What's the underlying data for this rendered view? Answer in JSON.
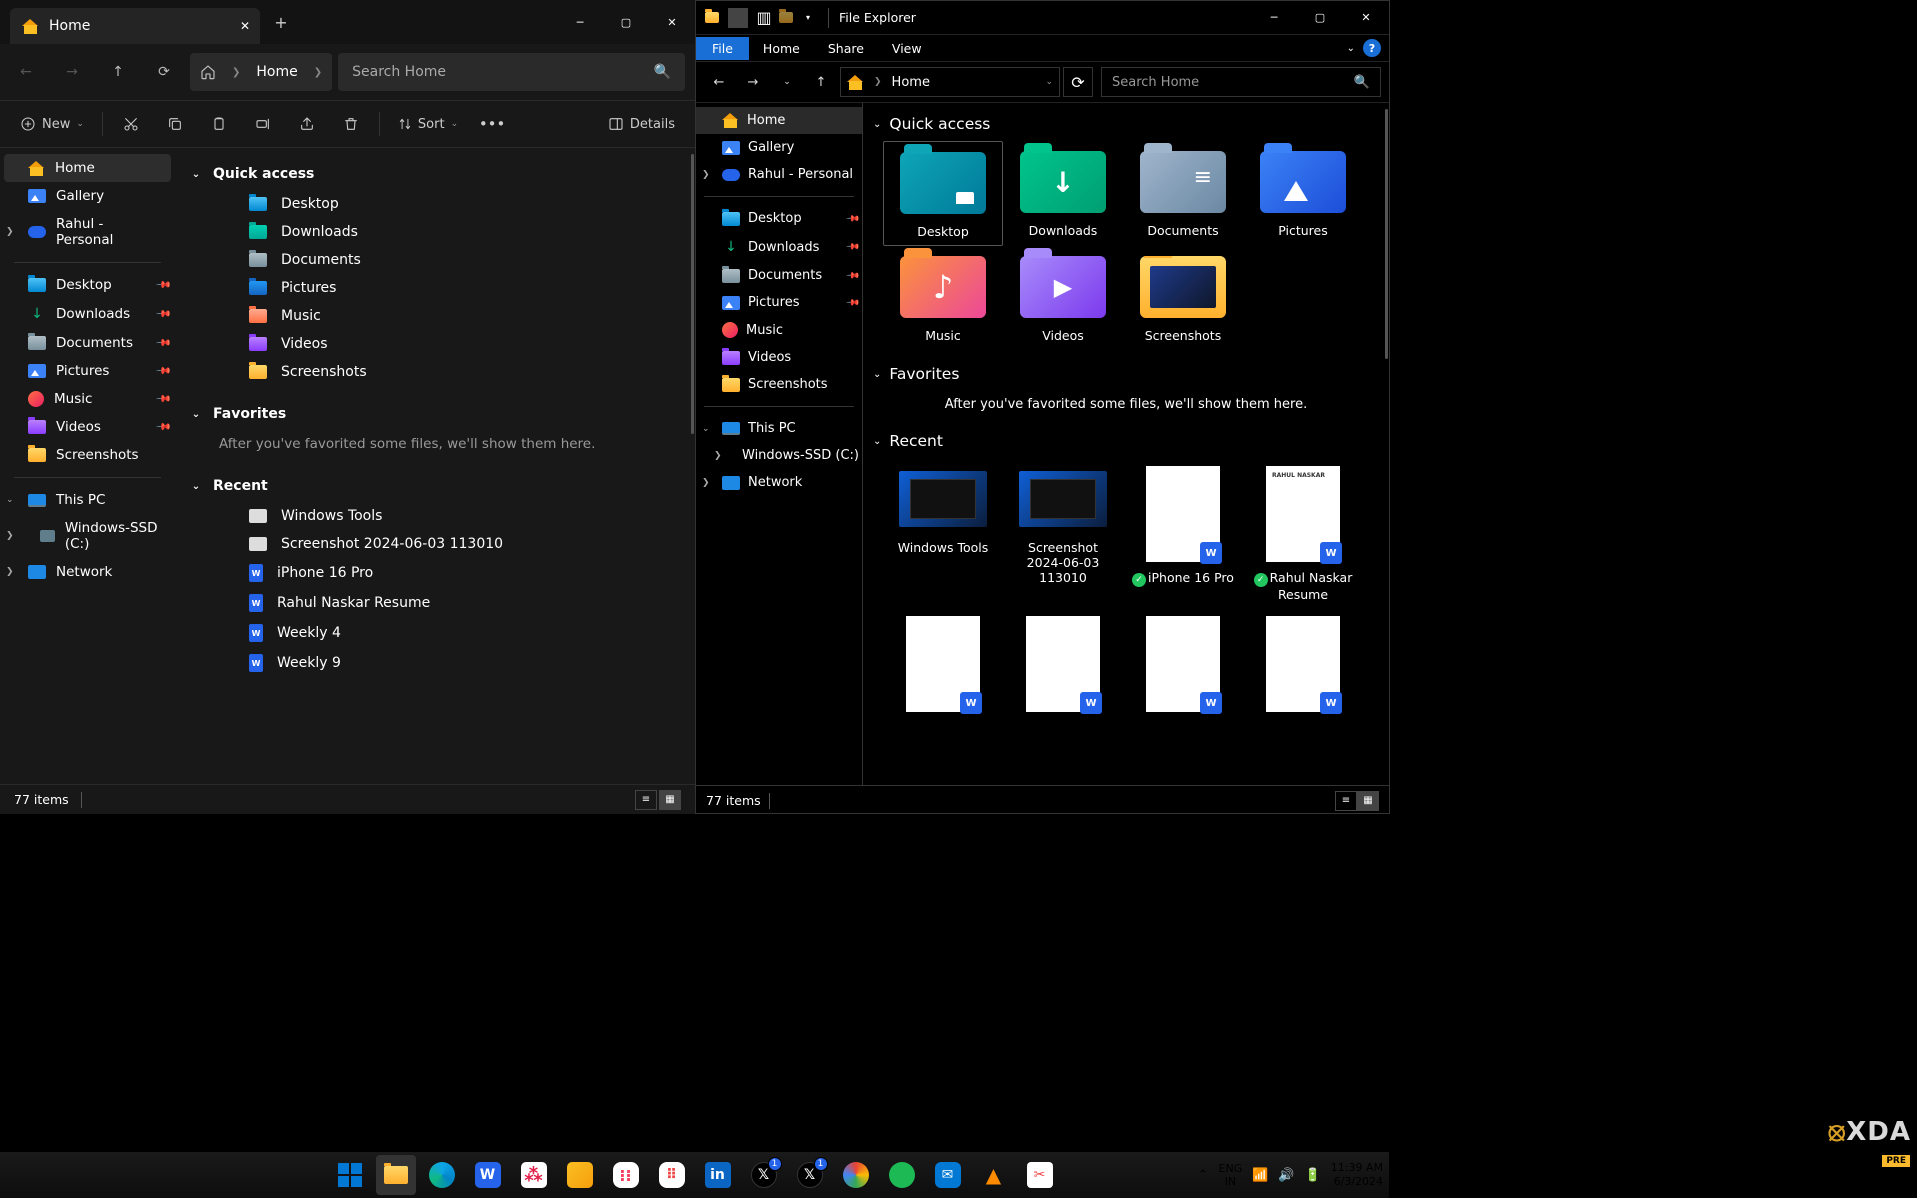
{
  "left": {
    "tab_title": "Home",
    "breadcrumb": "Home",
    "search_placeholder": "Search Home",
    "toolbar": {
      "new": "New",
      "sort": "Sort",
      "details": "Details"
    },
    "nav": {
      "home": "Home",
      "gallery": "Gallery",
      "personal": "Rahul - Personal",
      "pinned": [
        "Desktop",
        "Downloads",
        "Documents",
        "Pictures",
        "Music",
        "Videos",
        "Screenshots"
      ],
      "thispc": "This PC",
      "drives": [
        "Windows-SSD (C:)"
      ],
      "network": "Network"
    },
    "sections": {
      "quick": {
        "title": "Quick access",
        "items": [
          "Desktop",
          "Downloads",
          "Documents",
          "Pictures",
          "Music",
          "Videos",
          "Screenshots"
        ]
      },
      "favorites": {
        "title": "Favorites",
        "empty": "After you've favorited some files, we'll show them here."
      },
      "recent": {
        "title": "Recent",
        "items": [
          "Windows Tools",
          "Screenshot 2024-06-03 113010",
          "iPhone 16 Pro",
          "Rahul Naskar Resume",
          "Weekly 4",
          "Weekly 9"
        ]
      }
    },
    "status": "77 items"
  },
  "right": {
    "app_title": "File Explorer",
    "ribbon": {
      "file": "File",
      "tabs": [
        "Home",
        "Share",
        "View"
      ]
    },
    "breadcrumb": "Home",
    "search_placeholder": "Search Home",
    "nav": {
      "home": "Home",
      "gallery": "Gallery",
      "personal": "Rahul - Personal",
      "pinned": [
        "Desktop",
        "Downloads",
        "Documents",
        "Pictures",
        "Music",
        "Videos",
        "Screenshots"
      ],
      "thispc": "This PC",
      "drives": [
        "Windows-SSD (C:)"
      ],
      "network": "Network"
    },
    "sections": {
      "quick": {
        "title": "Quick access",
        "items": [
          "Desktop",
          "Downloads",
          "Documents",
          "Pictures",
          "Music",
          "Videos",
          "Screenshots"
        ]
      },
      "favorites": {
        "title": "Favorites",
        "empty": "After you've favorited some files, we'll show them here."
      },
      "recent": {
        "title": "Recent",
        "items": [
          "Windows Tools",
          "Screenshot 2024-06-03 113010",
          "iPhone 16 Pro",
          "Rahul Naskar Resume"
        ]
      }
    },
    "status": "77 items"
  },
  "tray": {
    "lang1": "ENG",
    "lang2": "IN",
    "time": "11:39 AM",
    "date": "6/3/2024"
  },
  "xda": {
    "brand": "XDA",
    "pre": "PRE"
  }
}
